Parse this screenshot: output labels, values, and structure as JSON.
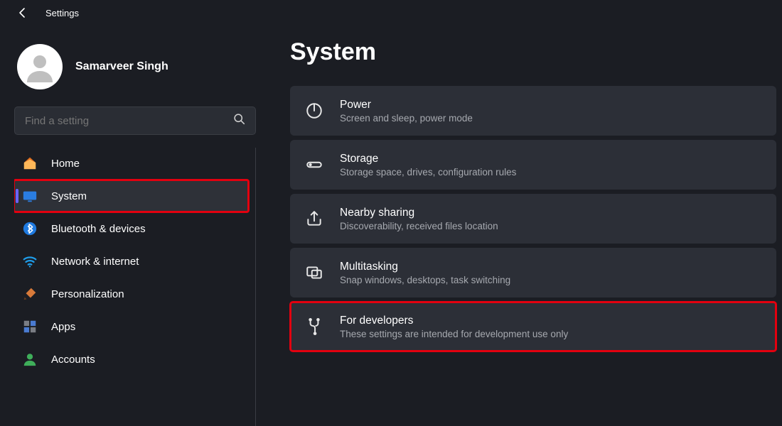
{
  "titlebar": {
    "label": "Settings"
  },
  "profile": {
    "name": "Samarveer Singh"
  },
  "search": {
    "placeholder": "Find a setting"
  },
  "sidebar": {
    "items": [
      {
        "label": "Home"
      },
      {
        "label": "System"
      },
      {
        "label": "Bluetooth & devices"
      },
      {
        "label": "Network & internet"
      },
      {
        "label": "Personalization"
      },
      {
        "label": "Apps"
      },
      {
        "label": "Accounts"
      }
    ]
  },
  "main": {
    "title": "System",
    "cards": [
      {
        "title": "Power",
        "desc": "Screen and sleep, power mode"
      },
      {
        "title": "Storage",
        "desc": "Storage space, drives, configuration rules"
      },
      {
        "title": "Nearby sharing",
        "desc": "Discoverability, received files location"
      },
      {
        "title": "Multitasking",
        "desc": "Snap windows, desktops, task switching"
      },
      {
        "title": "For developers",
        "desc": "These settings are intended for development use only"
      }
    ]
  }
}
